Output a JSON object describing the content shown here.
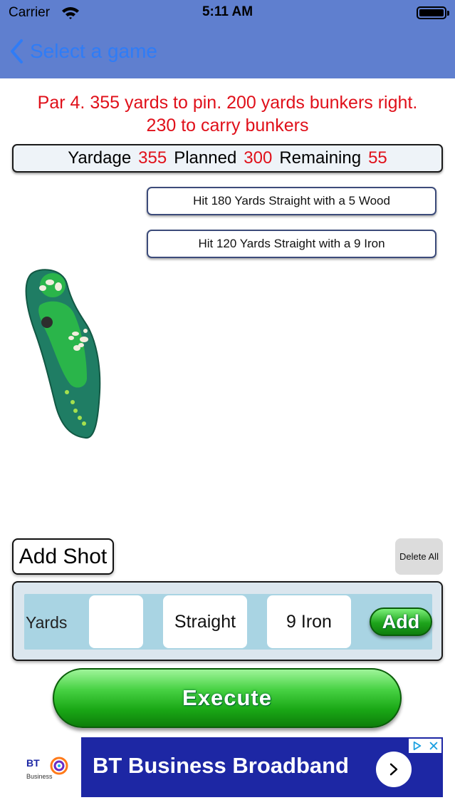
{
  "status_bar": {
    "carrier": "Carrier",
    "time": "5:11 AM"
  },
  "nav": {
    "back_label": "Select a game"
  },
  "hole": {
    "description_line1": "Par 4. 355 yards to pin. 200 yards bunkers right.",
    "description_line2": "230 to carry bunkers"
  },
  "yardage": {
    "yardage_label": "Yardage",
    "yardage_value": "355",
    "planned_label": "Planned",
    "planned_value": "300",
    "remaining_label": "Remaining",
    "remaining_value": "55"
  },
  "shots": [
    {
      "label": "Hit 180 Yards Straight with a 5 Wood"
    },
    {
      "label": "Hit 120 Yards Straight with a 9 Iron"
    }
  ],
  "controls": {
    "add_shot_label": "Add Shot",
    "delete_all_label": "Delete All"
  },
  "entry": {
    "yards_label": "Yards",
    "yards_value": "",
    "direction_value": "Straight",
    "club_value": "9 Iron",
    "add_label": "Add"
  },
  "execute_label": "Execute",
  "ad": {
    "brand": "BT",
    "brand_sub": "Business",
    "headline": "BT Business Broadband"
  },
  "colors": {
    "nav_bar": "#5f7fcf",
    "link_blue": "#2f7cf6",
    "alert_red": "#e0101a",
    "button_green": "#1ea41c",
    "ad_blue": "#1d27a4"
  },
  "icons": [
    "wifi-icon",
    "battery-icon",
    "back-chevron-icon",
    "hole-map-image",
    "chevron-right-icon",
    "ad-choices-icon",
    "close-icon"
  ]
}
